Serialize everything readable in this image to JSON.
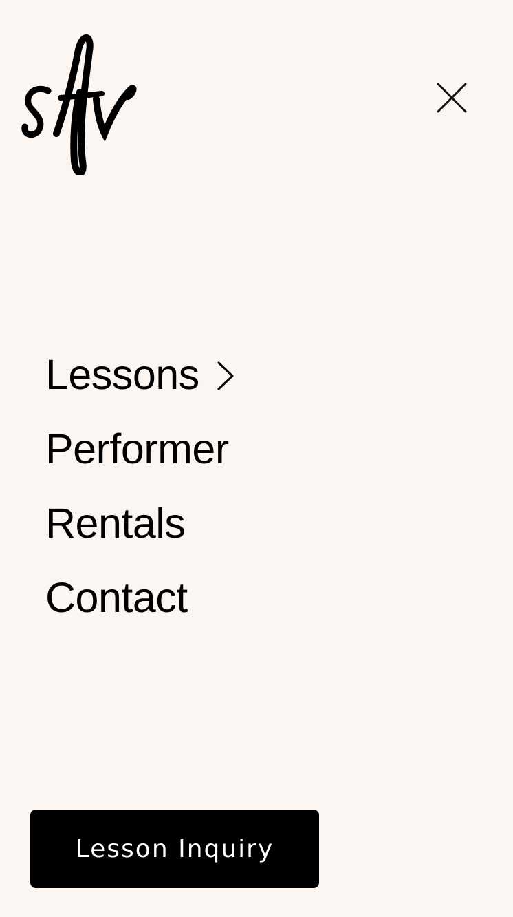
{
  "brand": {
    "logo_text": "sfv",
    "logo_icon": "script-monogram-logo"
  },
  "header": {
    "close_icon": "close-icon"
  },
  "menu": {
    "items": [
      {
        "label": "Lessons",
        "has_submenu": true,
        "icon": "chevron-right-icon"
      },
      {
        "label": "Performer",
        "has_submenu": false
      },
      {
        "label": "Rentals",
        "has_submenu": false
      },
      {
        "label": "Contact",
        "has_submenu": false
      }
    ]
  },
  "cta": {
    "label": "Lesson Inquiry"
  },
  "colors": {
    "background": "#fbf6f2",
    "text": "#000000",
    "button_background": "#000000",
    "button_text": "#ffffff"
  }
}
